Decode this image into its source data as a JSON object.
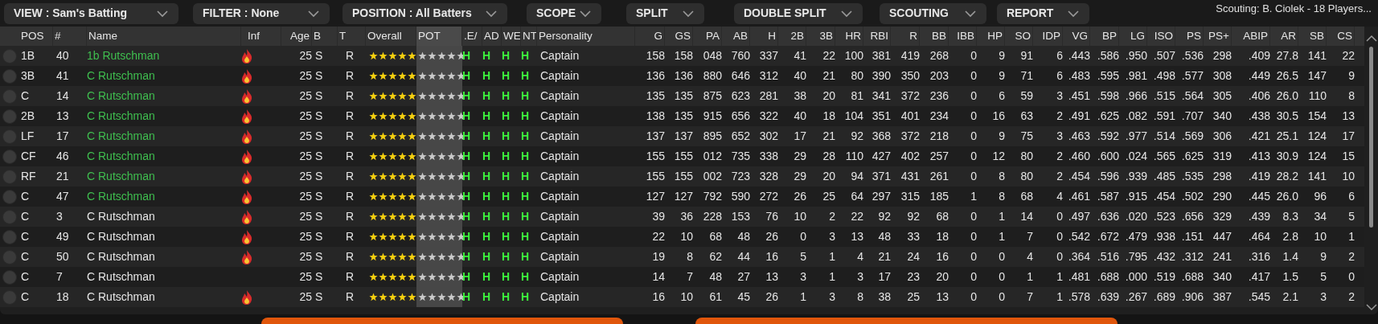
{
  "toolbar": {
    "buttons": [
      "VIEW : Sam's Batting",
      "FILTER : None",
      "POSITION : All Batters",
      "SCOPE",
      "SPLIT",
      "DOUBLE SPLIT",
      "SCOUTING",
      "REPORT"
    ],
    "scouting": "Scouting: B. Ciolek - 18 Players..."
  },
  "table": {
    "columns": [
      "POS",
      "#",
      "Name",
      "Inf",
      "Age",
      "B",
      "T",
      "Overall",
      "POT",
      ".E/",
      "AD",
      "WE",
      "NT",
      "Personality",
      "G",
      "GS",
      "PA",
      "AB",
      "H",
      "2B",
      "3B",
      "HR",
      "RBI",
      "R",
      "BB",
      "IBB",
      "HP",
      "SO",
      "IDP",
      "VG",
      "BP",
      "LG",
      "ISO",
      "PS",
      "PS+",
      "ABIP",
      "AR",
      "SB",
      "CS"
    ],
    "rows": [
      {
        "selected": false,
        "pos": "1B",
        "number": "40",
        "name": "1b Rutschman",
        "highlighted": true,
        "inf": true,
        "age": "25",
        "b": "S",
        "t": "R",
        "overall": {
          "stars": 5
        },
        "pot": {
          "stars": 5
        },
        "ratings": [
          "H",
          "H",
          "H",
          "H"
        ],
        "personality": "Captain",
        "stats": [
          "158",
          "158",
          "048",
          "760",
          "337",
          "41",
          "22",
          "100",
          "381",
          "419",
          "268",
          "0",
          "9",
          "91",
          "6",
          ".443",
          ".586",
          ".950",
          ".507",
          ".536",
          "298",
          ".409",
          "27.8",
          "141",
          "22"
        ]
      },
      {
        "selected": false,
        "pos": "3B",
        "number": "41",
        "name": "C Rutschman",
        "highlighted": true,
        "inf": true,
        "age": "25",
        "b": "S",
        "t": "R",
        "overall": {
          "stars": 5
        },
        "pot": {
          "stars": 5
        },
        "ratings": [
          "H",
          "H",
          "H",
          "H"
        ],
        "personality": "Captain",
        "stats": [
          "136",
          "136",
          "880",
          "646",
          "312",
          "40",
          "21",
          "80",
          "390",
          "350",
          "203",
          "0",
          "9",
          "71",
          "6",
          ".483",
          ".595",
          ".981",
          ".498",
          ".577",
          "308",
          ".449",
          "26.5",
          "147",
          "9"
        ]
      },
      {
        "selected": false,
        "pos": "C",
        "number": "14",
        "name": "C Rutschman",
        "highlighted": true,
        "inf": true,
        "age": "25",
        "b": "S",
        "t": "R",
        "overall": {
          "stars": 5
        },
        "pot": {
          "stars": 5
        },
        "ratings": [
          "H",
          "H",
          "H",
          "H"
        ],
        "personality": "Captain",
        "stats": [
          "135",
          "135",
          "875",
          "623",
          "281",
          "38",
          "20",
          "81",
          "341",
          "372",
          "236",
          "0",
          "6",
          "59",
          "3",
          ".451",
          ".598",
          ".966",
          ".515",
          ".564",
          "305",
          ".406",
          "26.0",
          "110",
          "8"
        ]
      },
      {
        "selected": false,
        "pos": "2B",
        "number": "13",
        "name": "C Rutschman",
        "highlighted": true,
        "inf": true,
        "age": "25",
        "b": "S",
        "t": "R",
        "overall": {
          "stars": 5
        },
        "pot": {
          "stars": 5
        },
        "ratings": [
          "H",
          "H",
          "H",
          "H"
        ],
        "personality": "Captain",
        "stats": [
          "138",
          "135",
          "915",
          "656",
          "322",
          "40",
          "18",
          "104",
          "351",
          "401",
          "234",
          "0",
          "16",
          "63",
          "2",
          ".491",
          ".625",
          ".082",
          ".591",
          ".707",
          "340",
          ".438",
          "30.5",
          "154",
          "13"
        ]
      },
      {
        "selected": false,
        "pos": "LF",
        "number": "17",
        "name": "C Rutschman",
        "highlighted": true,
        "inf": true,
        "age": "25",
        "b": "S",
        "t": "R",
        "overall": {
          "stars": 5
        },
        "pot": {
          "stars": 5
        },
        "ratings": [
          "H",
          "H",
          "H",
          "H"
        ],
        "personality": "Captain",
        "stats": [
          "137",
          "137",
          "895",
          "652",
          "302",
          "17",
          "21",
          "92",
          "368",
          "372",
          "218",
          "0",
          "9",
          "75",
          "3",
          ".463",
          ".592",
          ".977",
          ".514",
          ".569",
          "306",
          ".421",
          "25.1",
          "124",
          "17"
        ]
      },
      {
        "selected": false,
        "pos": "CF",
        "number": "46",
        "name": "C Rutschman",
        "highlighted": true,
        "inf": true,
        "age": "25",
        "b": "S",
        "t": "R",
        "overall": {
          "stars": 5
        },
        "pot": {
          "stars": 5
        },
        "ratings": [
          "H",
          "H",
          "H",
          "H"
        ],
        "personality": "Captain",
        "stats": [
          "155",
          "155",
          "012",
          "735",
          "338",
          "29",
          "28",
          "110",
          "427",
          "402",
          "257",
          "0",
          "12",
          "80",
          "2",
          ".460",
          ".600",
          ".024",
          ".565",
          ".625",
          "319",
          ".413",
          "30.9",
          "124",
          "15"
        ]
      },
      {
        "selected": false,
        "pos": "RF",
        "number": "21",
        "name": "C Rutschman",
        "highlighted": true,
        "inf": true,
        "age": "25",
        "b": "S",
        "t": "R",
        "overall": {
          "stars": 5
        },
        "pot": {
          "stars": 5
        },
        "ratings": [
          "H",
          "H",
          "H",
          "H"
        ],
        "personality": "Captain",
        "stats": [
          "155",
          "155",
          "002",
          "723",
          "328",
          "29",
          "20",
          "94",
          "371",
          "431",
          "261",
          "0",
          "8",
          "80",
          "2",
          ".454",
          ".596",
          ".939",
          ".485",
          ".535",
          "298",
          ".419",
          "28.2",
          "141",
          "10"
        ]
      },
      {
        "selected": false,
        "pos": "C",
        "number": "47",
        "name": "C Rutschman",
        "highlighted": true,
        "inf": true,
        "age": "25",
        "b": "S",
        "t": "R",
        "overall": {
          "stars": 5
        },
        "pot": {
          "stars": 5
        },
        "ratings": [
          "H",
          "H",
          "H",
          "H"
        ],
        "personality": "Captain",
        "stats": [
          "127",
          "127",
          "792",
          "590",
          "272",
          "26",
          "25",
          "64",
          "297",
          "315",
          "185",
          "1",
          "8",
          "68",
          "4",
          ".461",
          ".587",
          ".915",
          ".454",
          ".502",
          "290",
          ".445",
          "26.0",
          "96",
          "6"
        ]
      },
      {
        "selected": false,
        "pos": "C",
        "number": "3",
        "name": "C Rutschman",
        "highlighted": false,
        "inf": true,
        "age": "25",
        "b": "S",
        "t": "R",
        "overall": {
          "stars": 5
        },
        "pot": {
          "stars": 5
        },
        "ratings": [
          "H",
          "H",
          "H",
          "H"
        ],
        "personality": "Captain",
        "stats": [
          "39",
          "36",
          "228",
          "153",
          "76",
          "10",
          "2",
          "22",
          "92",
          "92",
          "68",
          "0",
          "1",
          "14",
          "0",
          ".497",
          ".636",
          ".020",
          ".523",
          ".656",
          "329",
          ".439",
          "8.3",
          "34",
          "5"
        ]
      },
      {
        "selected": false,
        "pos": "C",
        "number": "49",
        "name": "C Rutschman",
        "highlighted": false,
        "inf": true,
        "age": "25",
        "b": "S",
        "t": "R",
        "overall": {
          "stars": 5
        },
        "pot": {
          "stars": 5
        },
        "ratings": [
          "H",
          "H",
          "H",
          "H"
        ],
        "personality": "Captain",
        "stats": [
          "22",
          "10",
          "68",
          "48",
          "26",
          "0",
          "3",
          "13",
          "48",
          "33",
          "18",
          "0",
          "1",
          "7",
          "0",
          ".542",
          ".672",
          ".479",
          ".938",
          ".151",
          "447",
          ".464",
          "2.8",
          "10",
          "1"
        ]
      },
      {
        "selected": false,
        "pos": "C",
        "number": "50",
        "name": "C Rutschman",
        "highlighted": false,
        "inf": true,
        "age": "25",
        "b": "S",
        "t": "R",
        "overall": {
          "stars": 5
        },
        "pot": {
          "stars": 5
        },
        "ratings": [
          "H",
          "H",
          "H",
          "H"
        ],
        "personality": "Captain",
        "stats": [
          "19",
          "8",
          "62",
          "44",
          "16",
          "5",
          "1",
          "4",
          "21",
          "24",
          "16",
          "0",
          "0",
          "4",
          "0",
          ".364",
          ".516",
          ".795",
          ".432",
          ".312",
          "241",
          ".316",
          "1.4",
          "9",
          "2"
        ]
      },
      {
        "selected": false,
        "pos": "C",
        "number": "7",
        "name": "C Rutschman",
        "highlighted": false,
        "inf": false,
        "age": "25",
        "b": "S",
        "t": "R",
        "overall": {
          "stars": 5
        },
        "pot": {
          "stars": 5
        },
        "ratings": [
          "H",
          "H",
          "H",
          "H"
        ],
        "personality": "Captain",
        "stats": [
          "14",
          "7",
          "48",
          "27",
          "13",
          "3",
          "1",
          "3",
          "17",
          "23",
          "20",
          "0",
          "0",
          "1",
          "1",
          ".481",
          ".688",
          ".000",
          ".519",
          ".688",
          "340",
          ".417",
          "1.5",
          "5",
          "0"
        ]
      },
      {
        "selected": false,
        "pos": "C",
        "number": "18",
        "name": "C Rutschman",
        "highlighted": false,
        "inf": true,
        "age": "25",
        "b": "S",
        "t": "R",
        "overall": {
          "stars": 5
        },
        "pot": {
          "stars": 5
        },
        "ratings": [
          "H",
          "H",
          "H",
          "H"
        ],
        "personality": "Captain",
        "stats": [
          "16",
          "10",
          "61",
          "45",
          "26",
          "1",
          "3",
          "8",
          "38",
          "25",
          "13",
          "0",
          "0",
          "7",
          "1",
          ".578",
          ".639",
          ".267",
          ".689",
          ".906",
          "387",
          ".545",
          "2.1",
          "3",
          "2"
        ]
      }
    ]
  }
}
